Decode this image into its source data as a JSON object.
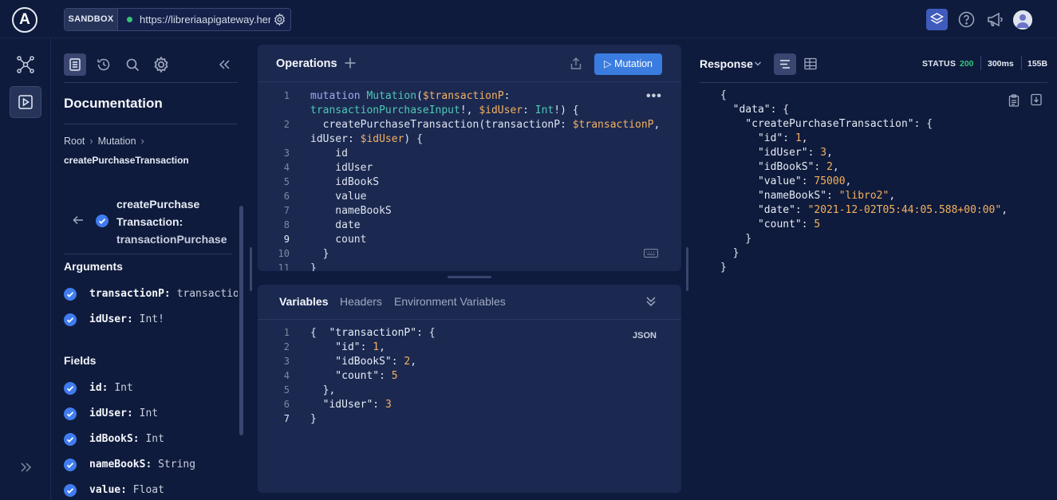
{
  "topbar": {
    "logo": "A",
    "sandbox_label": "SANDBOX",
    "endpoint_url": "https://libreriaapigateway.herokuapp.com/"
  },
  "docs": {
    "title": "Documentation",
    "breadcrumb": [
      "Root",
      "Mutation"
    ],
    "breadcrumb_current": "createPurchaseTransaction",
    "field_name_line1": "createPurchase",
    "field_name_line2": "Transaction:",
    "field_type": "transactionPurchase",
    "arguments_title": "Arguments",
    "arguments": [
      {
        "name": "transactionP:",
        "type": "transactionPurchaseInput!"
      },
      {
        "name": "idUser:",
        "type": "Int!"
      }
    ],
    "fields_title": "Fields",
    "fields": [
      {
        "name": "id:",
        "type": "Int"
      },
      {
        "name": "idUser:",
        "type": "Int"
      },
      {
        "name": "idBookS:",
        "type": "Int"
      },
      {
        "name": "nameBookS:",
        "type": "String"
      },
      {
        "name": "value:",
        "type": "Float"
      }
    ]
  },
  "operations": {
    "title": "Operations",
    "run_label": "▷ Mutation",
    "active_line": 9,
    "line_numbers": [
      "1",
      "",
      "2",
      "",
      "3",
      "4",
      "5",
      "6",
      "7",
      "8",
      "9",
      "10",
      "11"
    ]
  },
  "variables": {
    "tabs": [
      "Variables",
      "Headers",
      "Environment Variables"
    ],
    "format_label": "JSON",
    "line_numbers": [
      "1",
      "2",
      "3",
      "4",
      "5",
      "6",
      "7"
    ],
    "active_line": 7
  },
  "response": {
    "title": "Response",
    "status_label": "STATUS",
    "status_code": "200",
    "time": "300ms",
    "size": "155B"
  },
  "colors": {
    "background": "#0f1b3c",
    "panel": "#1b2951",
    "accent": "#3a7ce0",
    "success": "#36c47a",
    "keyword": "#a2a8f0",
    "function": "#4fc8b4",
    "variable": "#f4b060"
  }
}
